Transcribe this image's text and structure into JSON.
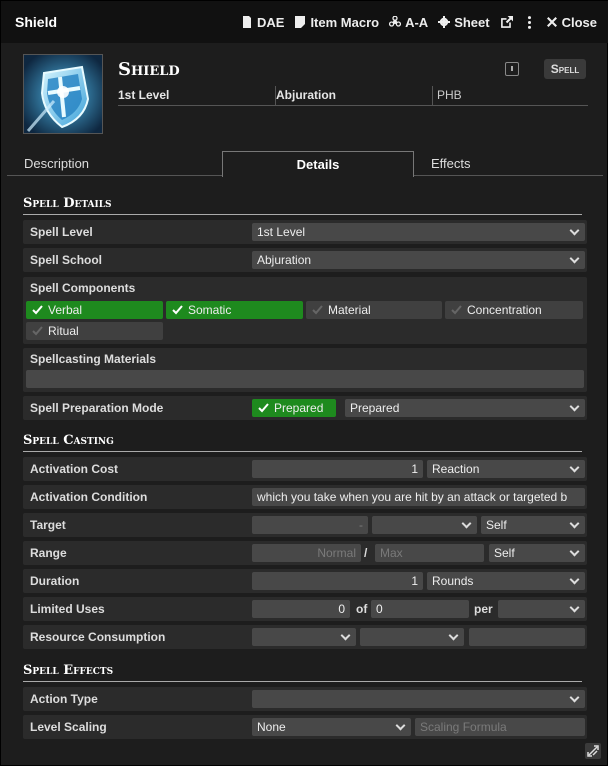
{
  "window": {
    "title": "Shield",
    "buttons": {
      "dae": "DAE",
      "item_macro": "Item Macro",
      "aa": "A-A",
      "sheet": "Sheet",
      "close": "Close"
    }
  },
  "header": {
    "name": "Shield",
    "type_badge": "Spell",
    "level": "1st Level",
    "school": "Abjuration",
    "source": "PHB"
  },
  "tabs": [
    "Description",
    "Details",
    "Effects"
  ],
  "spell_details": {
    "heading": "Spell Details",
    "spell_level": {
      "label": "Spell Level",
      "value": "1st Level"
    },
    "spell_school": {
      "label": "Spell School",
      "value": "Abjuration"
    },
    "components": {
      "label": "Spell Components",
      "items": [
        {
          "label": "Verbal",
          "checked": true
        },
        {
          "label": "Somatic",
          "checked": true
        },
        {
          "label": "Material",
          "checked": false
        },
        {
          "label": "Concentration",
          "checked": false
        },
        {
          "label": "Ritual",
          "checked": false
        }
      ]
    },
    "materials": {
      "label": "Spellcasting Materials",
      "value": ""
    },
    "preparation": {
      "label": "Spell Preparation Mode",
      "prepared_label": "Prepared",
      "mode": "Prepared"
    }
  },
  "spell_casting": {
    "heading": "Spell Casting",
    "activation_cost": {
      "label": "Activation Cost",
      "value": "1",
      "unit": "Reaction"
    },
    "activation_condition": {
      "label": "Activation Condition",
      "value": "which you take when you are hit by an attack or targeted b"
    },
    "target": {
      "label": "Target",
      "value_placeholder": "-",
      "type": "",
      "units": "Self"
    },
    "range": {
      "label": "Range",
      "normal_placeholder": "Normal",
      "separator": "/",
      "max_placeholder": "Max",
      "units": "Self"
    },
    "duration": {
      "label": "Duration",
      "value": "1",
      "units": "Rounds"
    },
    "limited_uses": {
      "label": "Limited Uses",
      "value": "0",
      "of_label": "of",
      "max": "0",
      "per_label": "per",
      "per": ""
    },
    "resource_consumption": {
      "label": "Resource Consumption",
      "type": "",
      "target": "",
      "amount": ""
    }
  },
  "spell_effects": {
    "heading": "Spell Effects",
    "action_type": {
      "label": "Action Type",
      "value": ""
    },
    "level_scaling": {
      "label": "Level Scaling",
      "value": "None",
      "formula_placeholder": "Scaling Formula"
    }
  },
  "colors": {
    "checked": "#1e8a1e",
    "panel": "#2b2b2b",
    "input": "#484848"
  }
}
